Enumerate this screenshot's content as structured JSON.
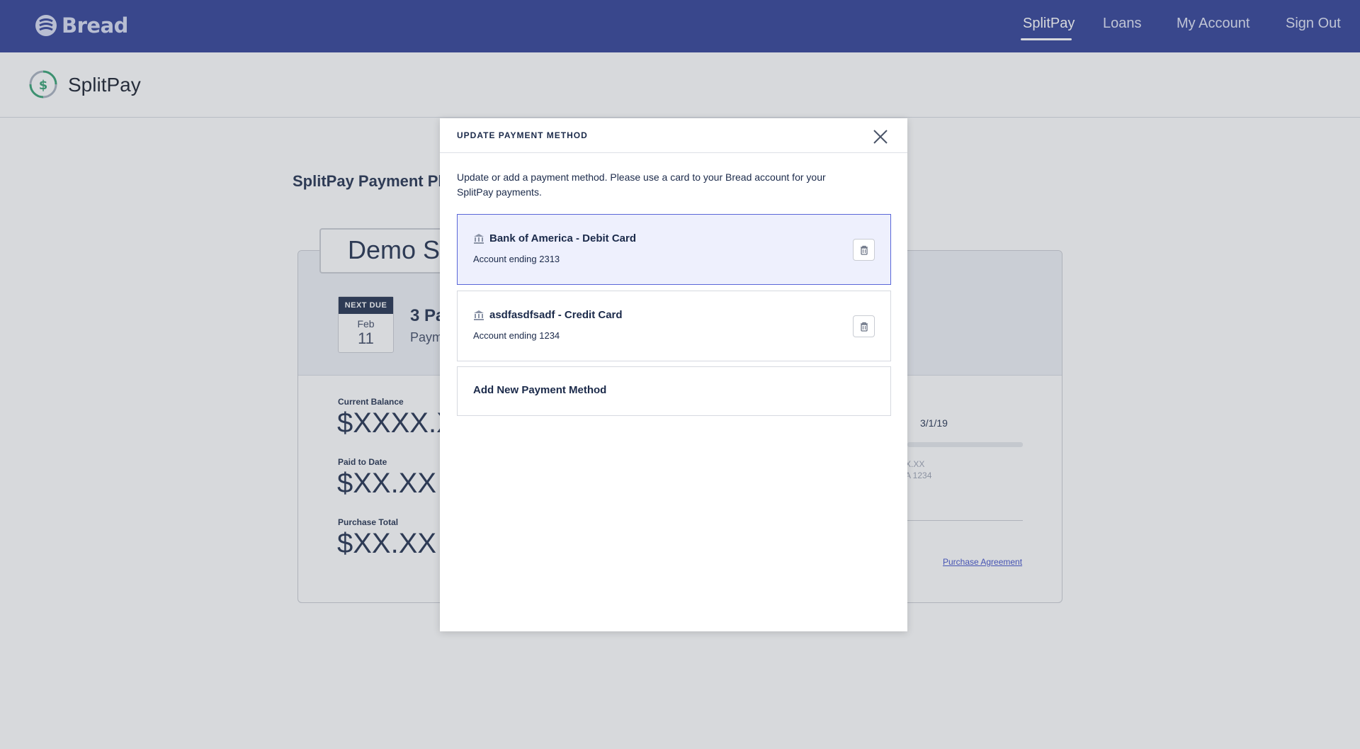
{
  "brand": {
    "name": "Bread"
  },
  "nav": {
    "items": [
      {
        "label": "SplitPay",
        "active": true
      },
      {
        "label": "Loans",
        "active": false
      },
      {
        "label": "My Account",
        "active": false
      },
      {
        "label": "Sign Out",
        "active": false
      }
    ]
  },
  "subheader": {
    "title": "SplitPay"
  },
  "page": {
    "plan_heading": "SplitPay Payment Pla",
    "store_name": "Demo St",
    "next_due": {
      "label": "NEXT DUE",
      "month": "Feb",
      "day": "11"
    },
    "payments_title": "3 Pa",
    "payments_sub": "Paym",
    "stats": [
      {
        "label": "Current Balance",
        "value": "$XXXX.X"
      },
      {
        "label": "Paid to Date",
        "value": "$XX.XX"
      },
      {
        "label": "Purchase Total",
        "value": "$XX.XX"
      }
    ],
    "right_date": "3/1/19",
    "faded_amount": "X.XX",
    "faded_account": "A 1234",
    "agreement_link": "Purchase Agreement"
  },
  "modal": {
    "title": "UPDATE PAYMENT METHOD",
    "description": "Update or add a payment method. Please use a card to your Bread account for your SplitPay payments.",
    "methods": [
      {
        "title": "Bank of America - Debit Card",
        "subtitle": "Account ending 2313",
        "selected": true
      },
      {
        "title": "asdfasdfsadf - Credit Card",
        "subtitle": "Account ending 1234",
        "selected": false
      }
    ],
    "add_label": "Add New Payment Method"
  },
  "colors": {
    "nav_bg": "#2b3a93",
    "accent": "#5a67d8",
    "selected_bg": "#eef0fd",
    "text": "#1b2a4a",
    "splitpay_green": "#2f9e6e"
  },
  "icons": {
    "brand": "bread-logo-icon",
    "splitpay": "dollar-circle-icon",
    "close": "close-icon",
    "bank": "bank-icon",
    "delete": "trash-icon"
  }
}
